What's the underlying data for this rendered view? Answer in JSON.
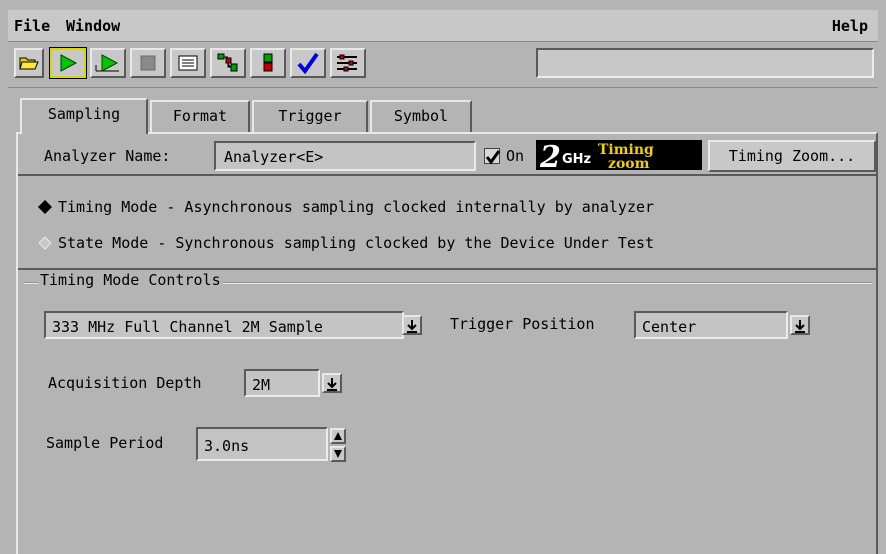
{
  "menubar": {
    "file": "File",
    "window": "Window",
    "help": "Help"
  },
  "toolbar": {
    "icons": [
      "open-folder-icon",
      "run-icon",
      "run-repetitive-icon",
      "stop-icon",
      "listing-icon",
      "overview-icon",
      "bus-icon",
      "check-icon",
      "tools-icon"
    ],
    "status_text": ""
  },
  "tabs": [
    {
      "label": "Sampling",
      "active": true
    },
    {
      "label": "Format"
    },
    {
      "label": "Trigger"
    },
    {
      "label": "Symbol"
    }
  ],
  "analyzer": {
    "name_label": "Analyzer Name:",
    "name_value": "Analyzer<E>",
    "on_label": "On",
    "on_checked": true,
    "logo_text_big": "2",
    "logo_text_ghz": "GHz",
    "logo_text_timing": "Timing",
    "logo_text_zoom": "zoom",
    "timing_zoom_button": "Timing Zoom..."
  },
  "modes": {
    "timing": "Timing Mode - Asynchronous sampling clocked internally by analyzer",
    "state": "State Mode  - Synchronous sampling clocked by the Device Under Test",
    "selected": "timing"
  },
  "controls": {
    "group_title": "Timing Mode Controls",
    "sampling_mode": "333 MHz Full Channel 2M Sample",
    "trigger_position_label": "Trigger Position",
    "trigger_position_value": "Center",
    "acquisition_depth_label": "Acquisition Depth",
    "acquisition_depth_value": "2M",
    "sample_period_label": "Sample Period",
    "sample_period_value": "3.0ns"
  },
  "colors": {
    "background": "#b4b4b4",
    "run_green": "#00c800",
    "check_blue": "#0000e0",
    "highlight": "#d8d800"
  }
}
